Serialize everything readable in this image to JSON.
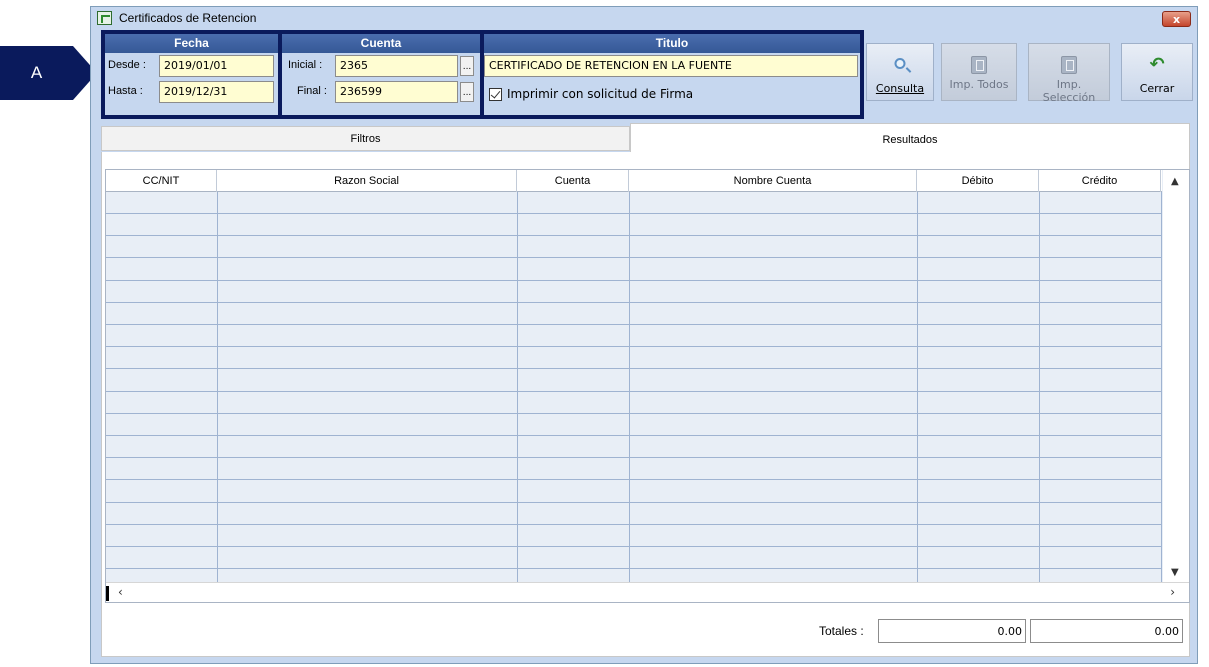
{
  "annotation": {
    "label": "A"
  },
  "window": {
    "title": "Certificados de Retencion",
    "close_glyph": "x"
  },
  "fecha": {
    "header": "Fecha",
    "desde_label": "Desde :",
    "desde_value": "2019/01/01",
    "hasta_label": "Hasta :",
    "hasta_value": "2019/12/31"
  },
  "cuenta": {
    "header": "Cuenta",
    "inicial_label": "Inicial :",
    "inicial_value": "2365",
    "final_label": "Final :",
    "final_value": "236599",
    "browse_glyph": "..."
  },
  "titulo": {
    "header": "Titulo",
    "value": "CERTIFICADO DE RETENCION EN LA FUENTE",
    "firma_label": "Imprimir con solicitud de Firma",
    "firma_checked": true
  },
  "toolbar": {
    "consulta": "Consulta",
    "imp_todos": "Imp. Todos",
    "imp_seleccion": "Imp. Selección",
    "cerrar": "Cerrar"
  },
  "tabs": {
    "filtros": "Filtros",
    "resultados": "Resultados",
    "active": "Resultados"
  },
  "grid": {
    "columns": [
      "CC/NIT",
      "Razon Social",
      "Cuenta",
      "Nombre Cuenta",
      "Débito",
      "Crédito"
    ],
    "rows": []
  },
  "totals": {
    "label": "Totales :",
    "debito": "0.00",
    "credito": "0.00"
  },
  "colors": {
    "frame": "#0a1a5c",
    "window_bg": "#c6d7ef",
    "field_bg": "#fffdd2",
    "grid_bg": "#e8eef6"
  }
}
